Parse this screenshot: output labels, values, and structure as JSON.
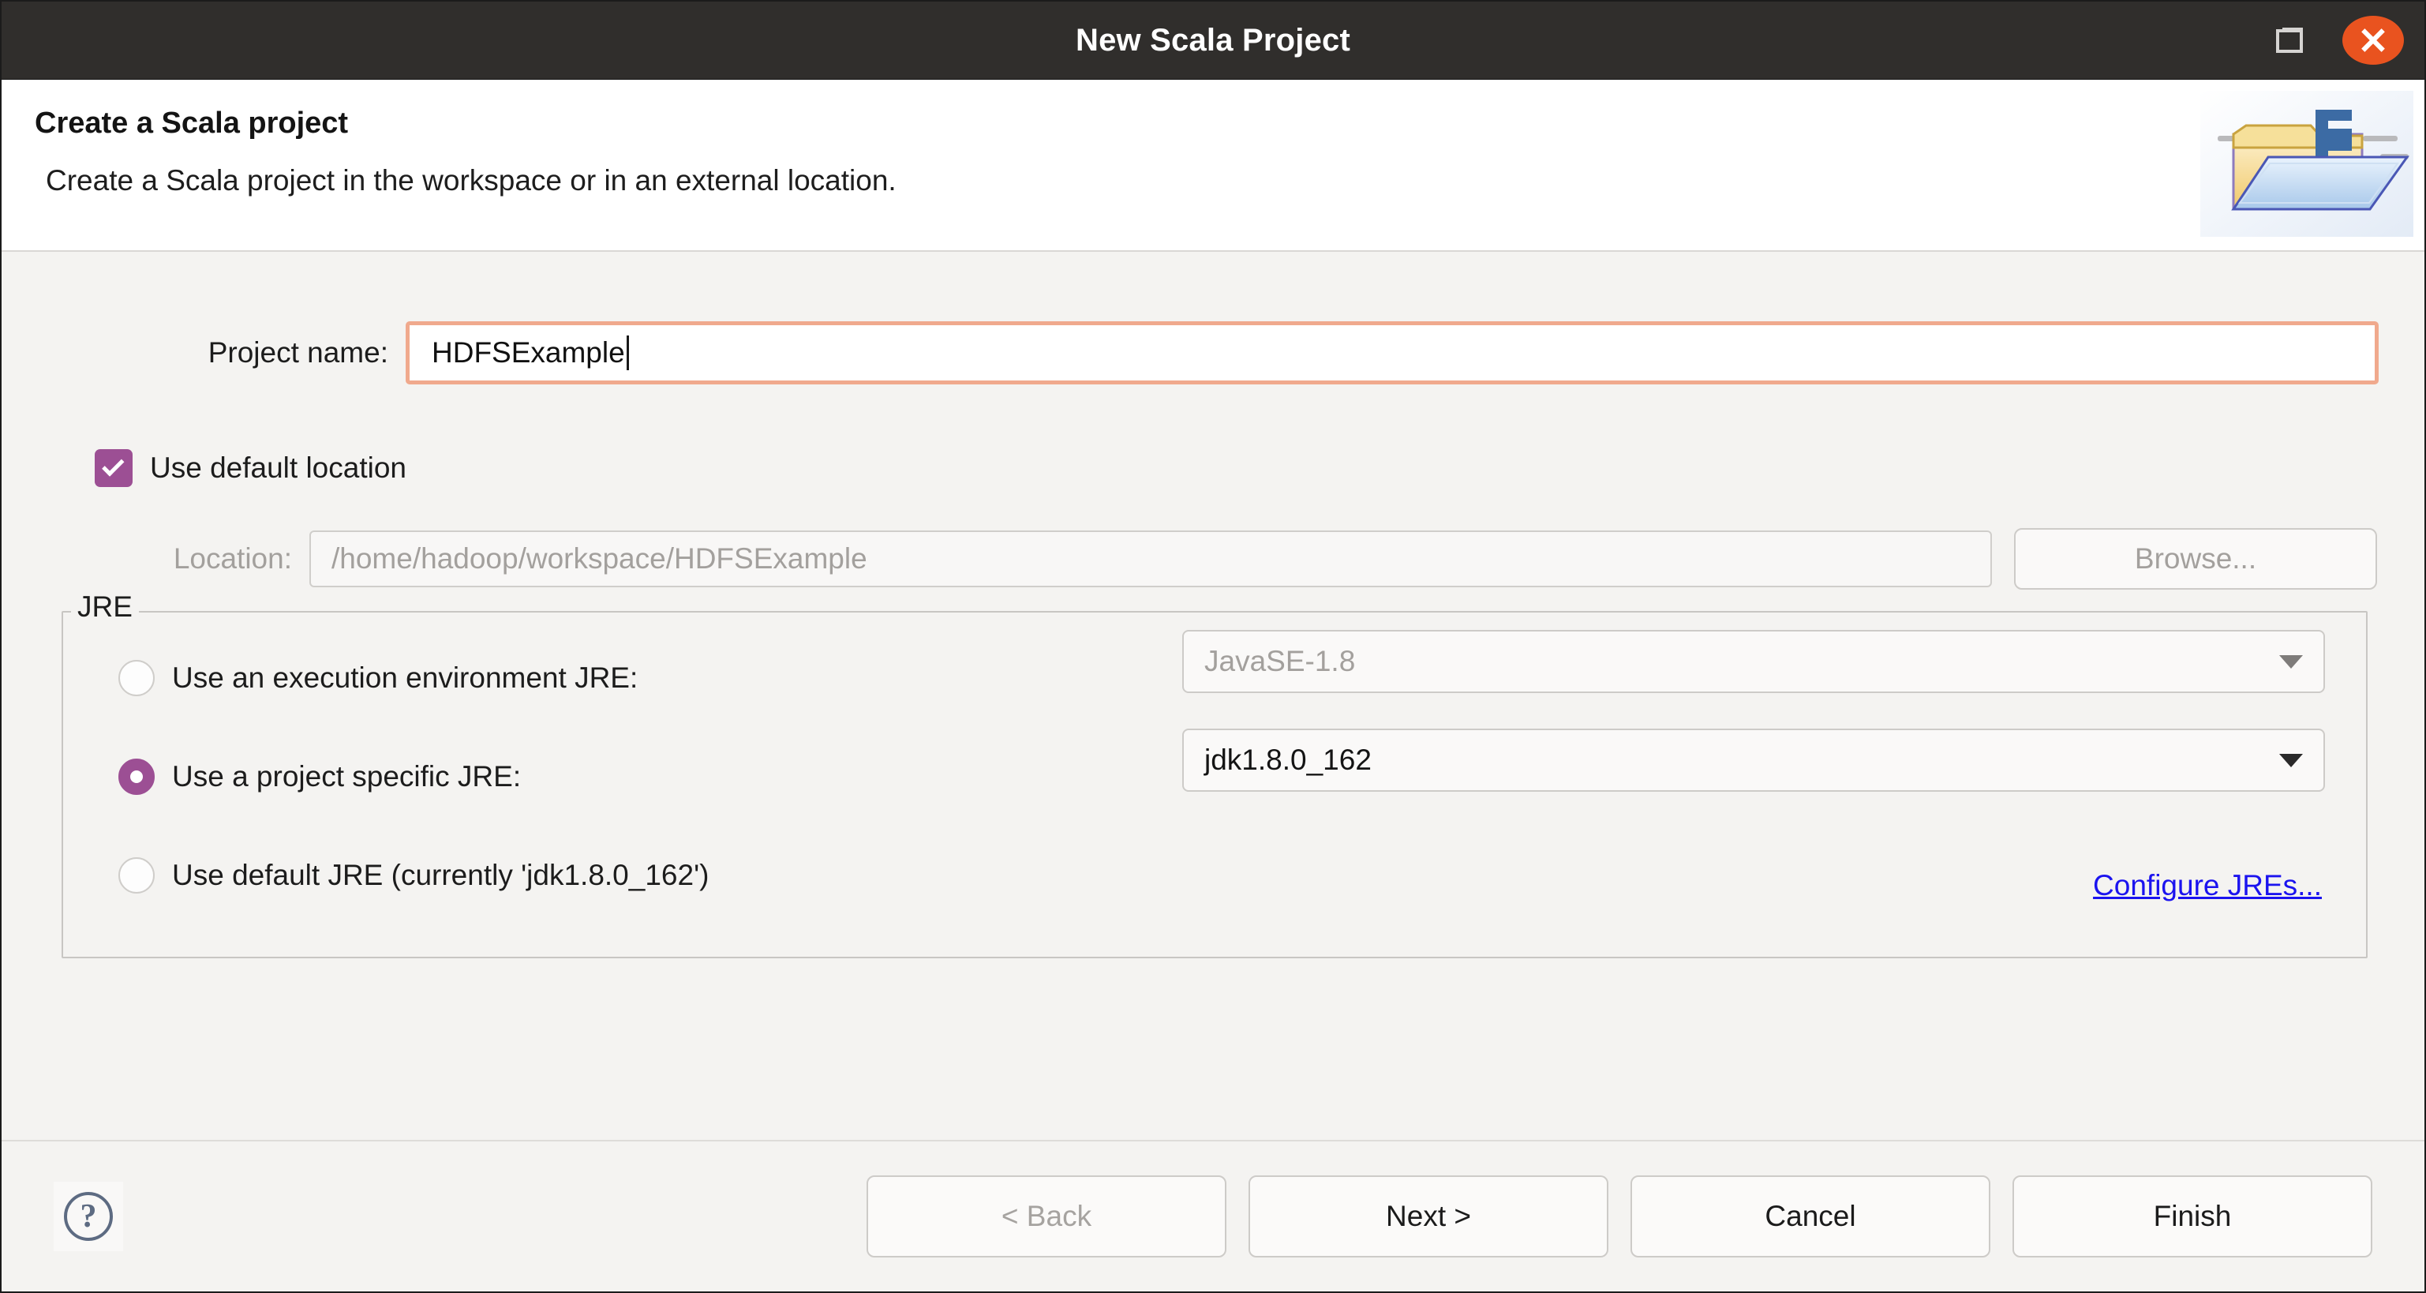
{
  "window": {
    "title": "New Scala Project",
    "controls": {
      "restore_icon": "restore-window-icon",
      "close_icon": "close-window-icon"
    }
  },
  "header": {
    "title": "Create a Scala project",
    "subtitle": "Create a Scala project in the workspace or in an external location.",
    "logo_icon": "scala-project-folder-icon"
  },
  "form": {
    "project_name_label": "Project name:",
    "project_name_value": "HDFSExample",
    "use_default_location_label": "Use default location",
    "use_default_location_checked": true,
    "location_label": "Location:",
    "location_value": "/home/hadoop/workspace/HDFSExample",
    "browse_label": "Browse..."
  },
  "jre": {
    "legend": "JRE",
    "options": [
      {
        "label": "Use an execution environment JRE:",
        "selected": false,
        "combo_value": "JavaSE-1.8"
      },
      {
        "label": "Use a project specific JRE:",
        "selected": true,
        "combo_value": "jdk1.8.0_162"
      },
      {
        "label": "Use default JRE (currently 'jdk1.8.0_162')",
        "selected": false
      }
    ],
    "configure_link": "Configure JREs..."
  },
  "footer": {
    "help_label": "?",
    "back_label": "< Back",
    "next_label": "Next >",
    "cancel_label": "Cancel",
    "finish_label": "Finish"
  },
  "colors": {
    "titlebar_bg": "#302e2c",
    "close_button": "#e9531f",
    "accent_purple": "#9c4f94",
    "focus_orange": "#f0a98d",
    "link_blue": "#1b13ef",
    "body_bg": "#f4f3f1"
  }
}
